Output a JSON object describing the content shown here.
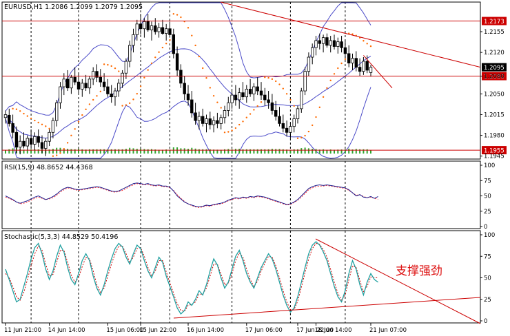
{
  "chart_data": {
    "type": "candlestick",
    "title": "EURUSD,H1  1.2086 1.2099 1.2079 1.2095",
    "annotation": "支撑强劲",
    "colors": {
      "bull": "#ffffff",
      "bear": "#000000",
      "bollinger": "#4a4ac8",
      "sar": "#ff6a00",
      "volume": "#2fa62f",
      "hline": "#cc0000",
      "trendline": "#cc0000",
      "rsi_main": "#1a1a8c",
      "rsi_signal": "#ff3030",
      "stoch_main": "#20a0a0",
      "stoch_signal": "#cc0000",
      "grid": "#000000",
      "label_bg": "#cc0000"
    },
    "x_labels": [
      "11 Jun 21:00",
      "14 Jun 14:00",
      "15 Jun 06:00",
      "15 Jun 22:00",
      "16 Jun 14:00",
      "17 Jun 06:00",
      "17 Jun 22:00",
      "18 Jun 14:00",
      "21 Jun 07:00"
    ],
    "price_panel": {
      "ylim": [
        1.194,
        1.2205
      ],
      "ticks": [
        "1.2155",
        "1.2120",
        "1.2080",
        "1.2050",
        "1.2015",
        "1.1980",
        "1.1945"
      ],
      "hlines": [
        {
          "price": 1.2173,
          "label": "1.2173"
        },
        {
          "price": 1.208,
          "label": "1.2080"
        },
        {
          "price": 1.1955,
          "label": "1.1955"
        }
      ],
      "current": {
        "price": 1.2095,
        "label": "1.2095"
      },
      "candles_ohlc": [
        [
          1.201,
          1.2022,
          1.2,
          1.2015
        ],
        [
          1.2014,
          1.2025,
          1.1995,
          1.2
        ],
        [
          1.2,
          1.2015,
          1.1975,
          1.1985
        ],
        [
          1.1985,
          1.1995,
          1.195,
          1.196
        ],
        [
          1.196,
          1.198,
          1.1948,
          1.197
        ],
        [
          1.197,
          1.1985,
          1.1958,
          1.1962
        ],
        [
          1.1962,
          1.198,
          1.1955,
          1.1975
        ],
        [
          1.1975,
          1.199,
          1.196,
          1.1965
        ],
        [
          1.1965,
          1.1985,
          1.1955,
          1.1978
        ],
        [
          1.1978,
          1.199,
          1.196,
          1.1968
        ],
        [
          1.1968,
          1.198,
          1.195,
          1.1958
        ],
        [
          1.1958,
          1.1975,
          1.1945,
          1.197
        ],
        [
          1.197,
          1.199,
          1.1962,
          1.1985
        ],
        [
          1.1985,
          1.201,
          1.1975,
          1.2005
        ],
        [
          1.2005,
          1.204,
          1.1995,
          1.2035
        ],
        [
          1.2035,
          1.207,
          1.2025,
          1.2062
        ],
        [
          1.2062,
          1.2085,
          1.2048,
          1.2075
        ],
        [
          1.2075,
          1.209,
          1.2055,
          1.206
        ],
        [
          1.206,
          1.2082,
          1.205,
          1.2078
        ],
        [
          1.2078,
          1.2095,
          1.2065,
          1.207
        ],
        [
          1.207,
          1.2085,
          1.205,
          1.2058
        ],
        [
          1.2058,
          1.2075,
          1.2045,
          1.2068
        ],
        [
          1.2068,
          1.2082,
          1.2055,
          1.206
        ],
        [
          1.206,
          1.208,
          1.205,
          1.2075
        ],
        [
          1.2075,
          1.2095,
          1.2065,
          1.2088
        ],
        [
          1.2088,
          1.21,
          1.207,
          1.2078
        ],
        [
          1.2078,
          1.2092,
          1.2062,
          1.207
        ],
        [
          1.207,
          1.2085,
          1.2055,
          1.2062
        ],
        [
          1.2062,
          1.2075,
          1.2045,
          1.205
        ],
        [
          1.205,
          1.2065,
          1.2035,
          1.2045
        ],
        [
          1.2045,
          1.206,
          1.203,
          1.2055
        ],
        [
          1.2055,
          1.2075,
          1.2045,
          1.2068
        ],
        [
          1.2068,
          1.209,
          1.206,
          1.2085
        ],
        [
          1.2085,
          1.211,
          1.2075,
          1.2105
        ],
        [
          1.2105,
          1.214,
          1.2095,
          1.2132
        ],
        [
          1.2132,
          1.216,
          1.212,
          1.215
        ],
        [
          1.215,
          1.2175,
          1.214,
          1.2168
        ],
        [
          1.2168,
          1.2185,
          1.215,
          1.216
        ],
        [
          1.216,
          1.2178,
          1.2145,
          1.2172
        ],
        [
          1.2172,
          1.2185,
          1.2155,
          1.2158
        ],
        [
          1.2158,
          1.2172,
          1.214,
          1.2165
        ],
        [
          1.2165,
          1.2178,
          1.215,
          1.2155
        ],
        [
          1.2155,
          1.217,
          1.2145,
          1.2162
        ],
        [
          1.2162,
          1.2175,
          1.215,
          1.2152
        ],
        [
          1.2152,
          1.2168,
          1.214,
          1.216
        ],
        [
          1.216,
          1.2172,
          1.2145,
          1.215
        ],
        [
          1.215,
          1.216,
          1.211,
          1.2118
        ],
        [
          1.2118,
          1.213,
          1.208,
          1.209
        ],
        [
          1.209,
          1.21,
          1.206,
          1.2068
        ],
        [
          1.2068,
          1.208,
          1.204,
          1.205
        ],
        [
          1.205,
          1.2065,
          1.203,
          1.204
        ],
        [
          1.204,
          1.2055,
          1.201,
          1.2018
        ],
        [
          1.2018,
          1.2035,
          1.1998,
          1.2005
        ],
        [
          1.2005,
          1.202,
          1.199,
          1.2012
        ],
        [
          1.2012,
          1.2025,
          1.1995,
          1.2
        ],
        [
          1.2,
          1.2015,
          1.1985,
          1.2008
        ],
        [
          1.2008,
          1.202,
          1.199,
          1.1998
        ],
        [
          1.1998,
          1.2012,
          1.1985,
          1.2005
        ],
        [
          1.2005,
          1.2018,
          1.1992,
          1.2
        ],
        [
          1.2,
          1.2015,
          1.199,
          1.201
        ],
        [
          1.201,
          1.203,
          1.2,
          1.2022
        ],
        [
          1.2022,
          1.2045,
          1.2012,
          1.2035
        ],
        [
          1.2035,
          1.2055,
          1.2025,
          1.2048
        ],
        [
          1.2048,
          1.2065,
          1.203,
          1.204
        ],
        [
          1.204,
          1.206,
          1.2025,
          1.2052
        ],
        [
          1.2052,
          1.207,
          1.204,
          1.2045
        ],
        [
          1.2045,
          1.2065,
          1.2035,
          1.2058
        ],
        [
          1.2058,
          1.2075,
          1.2045,
          1.205
        ],
        [
          1.205,
          1.2068,
          1.2038,
          1.2062
        ],
        [
          1.2062,
          1.2078,
          1.2048,
          1.2055
        ],
        [
          1.2055,
          1.207,
          1.204,
          1.2048
        ],
        [
          1.2048,
          1.206,
          1.203,
          1.204
        ],
        [
          1.204,
          1.2055,
          1.2025,
          1.2035
        ],
        [
          1.2035,
          1.205,
          1.2015,
          1.2022
        ],
        [
          1.2022,
          1.2038,
          1.2005,
          1.2012
        ],
        [
          1.2012,
          1.2028,
          1.1995,
          1.2
        ],
        [
          1.2,
          1.2015,
          1.1985,
          1.1992
        ],
        [
          1.1992,
          1.2005,
          1.1978,
          1.1985
        ],
        [
          1.1985,
          1.2,
          1.1975,
          1.1995
        ],
        [
          1.1995,
          1.2015,
          1.1985,
          1.2008
        ],
        [
          1.2008,
          1.203,
          1.2,
          1.2025
        ],
        [
          1.2025,
          1.206,
          1.2018,
          1.2055
        ],
        [
          1.2055,
          1.2095,
          1.2048,
          1.2088
        ],
        [
          1.2088,
          1.212,
          1.208,
          1.2112
        ],
        [
          1.2112,
          1.2135,
          1.21,
          1.2128
        ],
        [
          1.2128,
          1.2148,
          1.2115,
          1.214
        ],
        [
          1.214,
          1.2152,
          1.2125,
          1.2135
        ],
        [
          1.2135,
          1.215,
          1.212,
          1.2145
        ],
        [
          1.2145,
          1.2152,
          1.2128,
          1.2132
        ],
        [
          1.2132,
          1.2148,
          1.212,
          1.214
        ],
        [
          1.214,
          1.215,
          1.2125,
          1.213
        ],
        [
          1.213,
          1.2145,
          1.2118,
          1.2138
        ],
        [
          1.2138,
          1.2148,
          1.212,
          1.2128
        ],
        [
          1.2128,
          1.214,
          1.211,
          1.2118
        ],
        [
          1.2118,
          1.2132,
          1.2095,
          1.2102
        ],
        [
          1.2102,
          1.2118,
          1.209,
          1.211
        ],
        [
          1.211,
          1.2122,
          1.2088,
          1.2095
        ],
        [
          1.2095,
          1.211,
          1.208,
          1.2088
        ],
        [
          1.2088,
          1.2112,
          1.2082,
          1.2105
        ],
        [
          1.2105,
          1.2115,
          1.2085,
          1.209
        ],
        [
          1.2086,
          1.2099,
          1.2079,
          1.2095
        ]
      ]
    },
    "rsi_panel": {
      "label": "RSI(15,9)  48.8652  44.4368",
      "ylim": [
        0,
        100
      ],
      "ticks": [
        "100",
        "75",
        "50",
        "25",
        "0"
      ],
      "main": [
        50,
        47,
        44,
        40,
        38,
        40,
        42,
        45,
        48,
        50,
        47,
        44,
        46,
        49,
        53,
        58,
        62,
        64,
        63,
        61,
        60,
        61,
        62,
        63,
        64,
        65,
        64,
        62,
        60,
        58,
        57,
        58,
        61,
        64,
        67,
        70,
        71,
        70,
        69,
        70,
        68,
        67,
        68,
        66,
        66,
        64,
        58,
        50,
        45,
        40,
        37,
        35,
        33,
        32,
        33,
        35,
        34,
        36,
        37,
        38,
        40,
        43,
        45,
        47,
        46,
        48,
        47,
        49,
        48,
        50,
        49,
        48,
        46,
        44,
        42,
        40,
        38,
        36,
        37,
        40,
        44,
        50,
        56,
        62,
        65,
        67,
        68,
        67,
        68,
        67,
        66,
        65,
        64,
        63,
        60,
        55,
        50,
        52,
        48,
        47,
        49,
        46,
        48.9
      ],
      "signal": [
        48,
        46,
        43,
        40,
        37,
        38,
        40,
        43,
        46,
        48,
        46,
        44,
        45,
        47,
        51,
        56,
        60,
        63,
        62,
        60,
        59,
        60,
        61,
        62,
        63,
        64,
        63,
        61,
        59,
        57,
        56,
        57,
        59,
        62,
        65,
        68,
        70,
        69,
        68,
        69,
        67,
        66,
        67,
        65,
        65,
        63,
        59,
        52,
        46,
        41,
        37,
        34,
        32,
        31,
        32,
        34,
        33,
        35,
        36,
        37,
        39,
        42,
        44,
        46,
        45,
        47,
        46,
        48,
        47,
        49,
        48,
        47,
        45,
        43,
        41,
        39,
        37,
        35,
        36,
        39,
        43,
        48,
        54,
        60,
        63,
        65,
        66,
        66,
        67,
        66,
        65,
        64,
        63,
        62,
        59,
        55,
        51,
        52,
        49,
        47,
        48,
        46,
        44.4
      ]
    },
    "stoch_panel": {
      "label": "Stochastic(5,3,3)  44.8529  50.4196",
      "ylim": [
        0,
        100
      ],
      "ticks": [
        "100",
        "75",
        "50",
        "25",
        "0"
      ],
      "main": [
        60,
        48,
        35,
        22,
        25,
        40,
        55,
        72,
        85,
        90,
        78,
        60,
        48,
        58,
        75,
        88,
        80,
        62,
        48,
        42,
        55,
        70,
        78,
        70,
        52,
        38,
        30,
        42,
        58,
        72,
        84,
        90,
        86,
        74,
        66,
        78,
        88,
        84,
        70,
        58,
        50,
        62,
        74,
        68,
        52,
        40,
        28,
        15,
        8,
        12,
        22,
        18,
        25,
        35,
        30,
        42,
        58,
        72,
        65,
        50,
        38,
        45,
        60,
        75,
        82,
        70,
        55,
        45,
        38,
        50,
        62,
        70,
        78,
        72,
        60,
        45,
        30,
        18,
        10,
        15,
        28,
        45,
        62,
        78,
        88,
        92,
        88,
        80,
        70,
        55,
        40,
        28,
        22,
        35,
        55,
        70,
        60,
        42,
        30,
        45,
        55,
        48,
        44.9
      ],
      "signal": [
        55,
        50,
        40,
        28,
        24,
        33,
        48,
        64,
        78,
        87,
        82,
        66,
        52,
        54,
        68,
        82,
        82,
        68,
        53,
        45,
        50,
        63,
        74,
        72,
        58,
        42,
        33,
        38,
        52,
        66,
        78,
        87,
        87,
        78,
        68,
        74,
        84,
        85,
        75,
        62,
        52,
        58,
        70,
        70,
        57,
        44,
        32,
        20,
        12,
        11,
        18,
        19,
        22,
        31,
        31,
        38,
        52,
        66,
        66,
        54,
        42,
        44,
        55,
        70,
        79,
        74,
        60,
        48,
        40,
        46,
        58,
        67,
        75,
        74,
        64,
        50,
        35,
        22,
        13,
        13,
        23,
        39,
        56,
        72,
        84,
        90,
        89,
        83,
        74,
        60,
        45,
        32,
        24,
        30,
        48,
        64,
        62,
        47,
        34,
        40,
        51,
        50,
        50.4
      ]
    }
  }
}
